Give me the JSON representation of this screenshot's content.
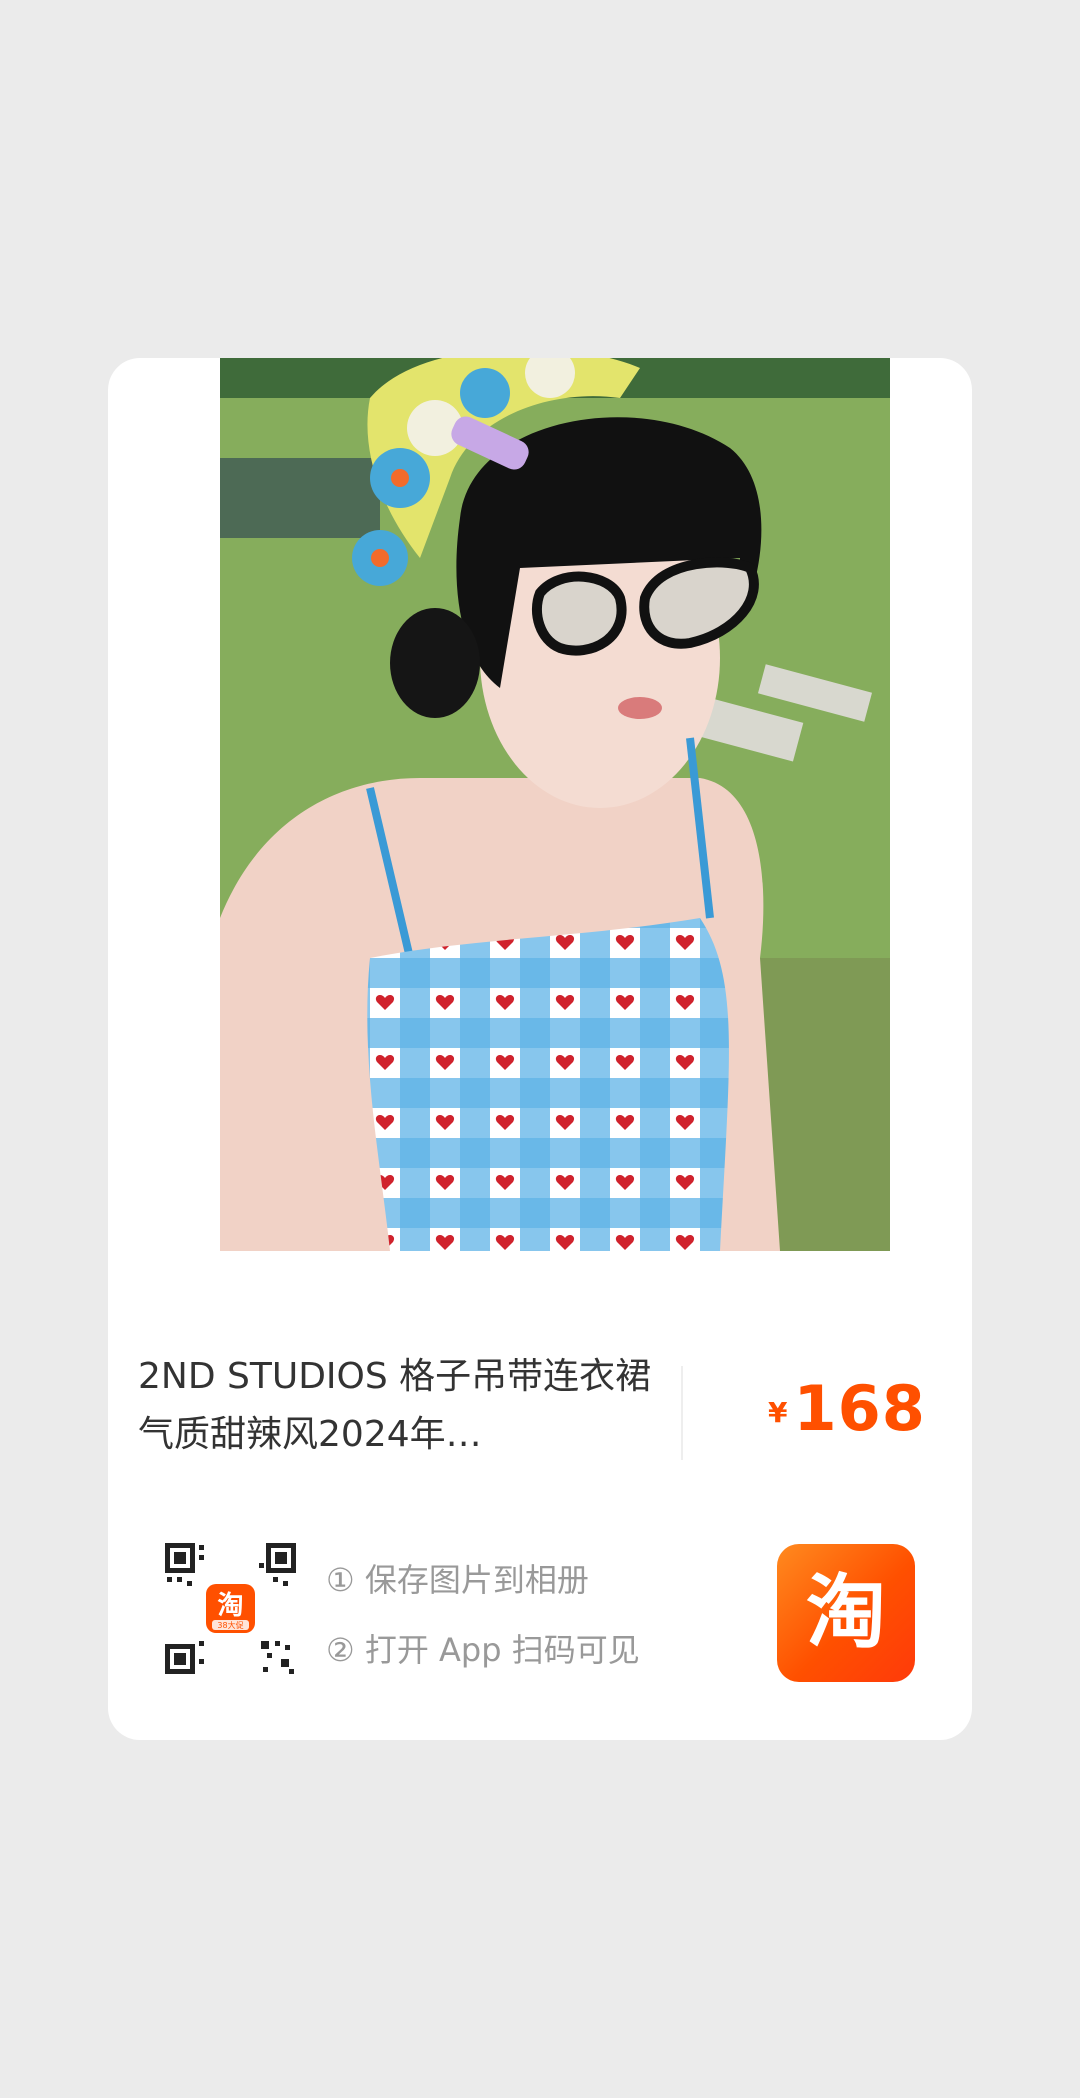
{
  "product": {
    "title": "2ND STUDIOS 格子吊带连衣裙气质甜辣风2024年…",
    "price_symbol": "¥",
    "price": "168"
  },
  "qr": {
    "center_logo": "淘",
    "center_sub": "38大促"
  },
  "instructions": {
    "step1": "① 保存图片到相册",
    "step2": "② 打开 App 扫码可见"
  },
  "app_badge": {
    "label": "淘"
  },
  "colors": {
    "accent": "#ff5000",
    "background": "#ebebeb",
    "card": "#ffffff"
  }
}
